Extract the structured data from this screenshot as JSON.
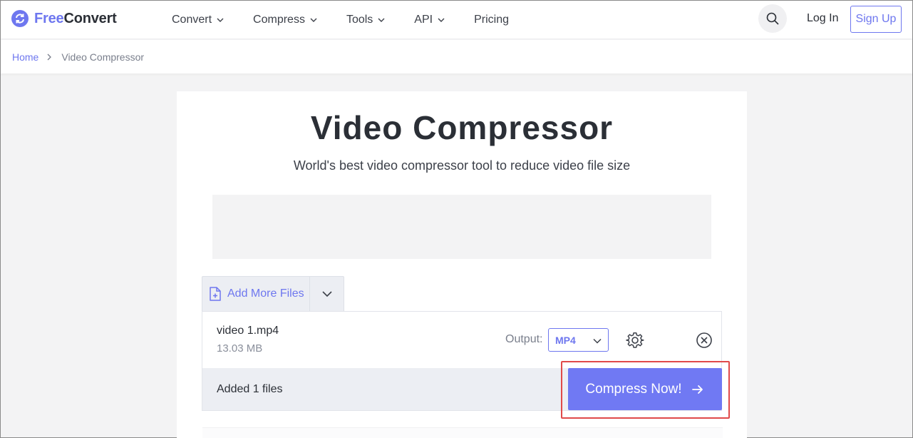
{
  "brand": {
    "name_part1": "Free",
    "name_part2": "Convert",
    "accent": "#6e77ef"
  },
  "nav": {
    "items": [
      {
        "label": "Convert",
        "has_dropdown": true
      },
      {
        "label": "Compress",
        "has_dropdown": true
      },
      {
        "label": "Tools",
        "has_dropdown": true
      },
      {
        "label": "API",
        "has_dropdown": true
      },
      {
        "label": "Pricing",
        "has_dropdown": false
      }
    ],
    "search_icon": "search-icon",
    "login_label": "Log In",
    "signup_label": "Sign Up"
  },
  "breadcrumb": {
    "home": "Home",
    "current": "Video Compressor"
  },
  "page": {
    "title": "Video Compressor",
    "subtitle": "World's best video compressor tool to reduce video file size"
  },
  "uploader": {
    "add_more_label": "Add More Files",
    "file": {
      "name": "video 1.mp4",
      "size": "13.03 MB",
      "output_label": "Output:",
      "output_format": "MP4"
    },
    "added_count": "Added 1 files",
    "compress_label": "Compress Now!",
    "highlight_color": "#e04a4a"
  }
}
